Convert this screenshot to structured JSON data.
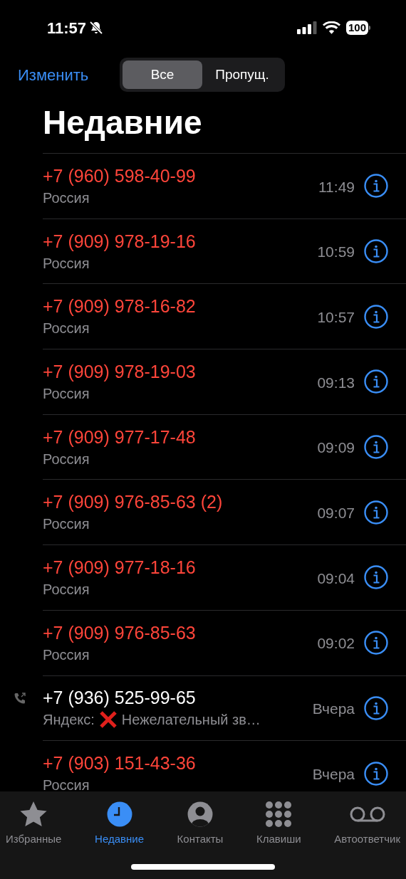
{
  "status_bar": {
    "time": "11:57",
    "silent": true,
    "battery": "100"
  },
  "header": {
    "edit": "Изменить",
    "segments": [
      {
        "label": "Все",
        "selected": true
      },
      {
        "label": "Пропущ.",
        "selected": false
      }
    ]
  },
  "title": "Недавние",
  "calls": [
    {
      "kind": "missed",
      "number": "+7 (960) 598-40-99",
      "subtitle": "Россия",
      "time": "11:49"
    },
    {
      "kind": "missed",
      "number": "+7 (909) 978-19-16",
      "subtitle": "Россия",
      "time": "10:59"
    },
    {
      "kind": "missed",
      "number": "+7 (909) 978-16-82",
      "subtitle": "Россия",
      "time": "10:57"
    },
    {
      "kind": "missed",
      "number": "+7 (909) 978-19-03",
      "subtitle": "Россия",
      "time": "09:13"
    },
    {
      "kind": "missed",
      "number": "+7 (909) 977-17-48",
      "subtitle": "Россия",
      "time": "09:09"
    },
    {
      "kind": "missed",
      "number": "+7 (909) 976-85-63 (2)",
      "subtitle": "Россия",
      "time": "09:07"
    },
    {
      "kind": "missed",
      "number": "+7 (909) 977-18-16",
      "subtitle": "Россия",
      "time": "09:04"
    },
    {
      "kind": "missed",
      "number": "+7 (909) 976-85-63",
      "subtitle": "Россия",
      "time": "09:02"
    },
    {
      "kind": "outgoing",
      "number": "+7 (936) 525-99-65",
      "subtitle_prefix": "Яндекс:",
      "spam_mark": true,
      "subtitle": "Нежелательный зв…",
      "time": "Вчера"
    },
    {
      "kind": "missed",
      "number": "+7 (903) 151-43-36",
      "subtitle": "Россия",
      "time": "Вчера"
    }
  ],
  "tabs": [
    {
      "kind": "favorites",
      "label": "Избранные",
      "selected": false
    },
    {
      "kind": "recents",
      "label": "Недавние",
      "selected": true
    },
    {
      "kind": "contacts",
      "label": "Контакты",
      "selected": false
    },
    {
      "kind": "keypad",
      "label": "Клавиши",
      "selected": false
    },
    {
      "kind": "voicemail",
      "label": "Автоответчик",
      "selected": false
    }
  ]
}
